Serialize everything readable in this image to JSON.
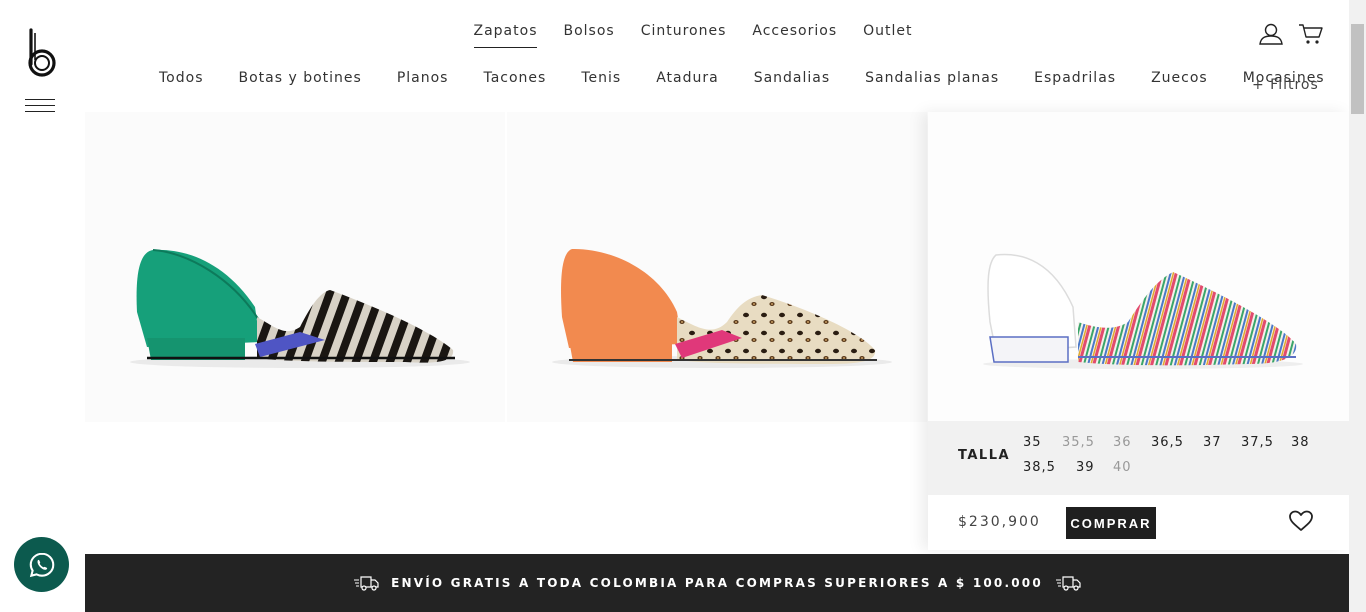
{
  "nav": {
    "items": [
      {
        "label": "Zapatos",
        "active": true
      },
      {
        "label": "Bolsos",
        "active": false
      },
      {
        "label": "Cinturones",
        "active": false
      },
      {
        "label": "Accesorios",
        "active": false
      },
      {
        "label": "Outlet",
        "active": false
      }
    ]
  },
  "header_icons": [
    "user-icon",
    "cart-icon"
  ],
  "categories": [
    "Todos",
    "Botas y botines",
    "Planos",
    "Tacones",
    "Tenis",
    "Atadura",
    "Sandalias",
    "Sandalias planas",
    "Espadrilas",
    "Zuecos",
    "Mocasines"
  ],
  "filters_label": "+ Filtros",
  "products": [
    {
      "image": "green-zebra-flat-shoe"
    },
    {
      "image": "orange-leopard-flat-shoe"
    },
    {
      "image": "white-striped-flat-shoe",
      "size_label": "TALLA",
      "sizes": [
        {
          "value": "35",
          "available": true
        },
        {
          "value": "35,5",
          "available": false
        },
        {
          "value": "36",
          "available": false
        },
        {
          "value": "36,5",
          "available": true
        },
        {
          "value": "37",
          "available": true
        },
        {
          "value": "37,5",
          "available": true
        },
        {
          "value": "38",
          "available": true
        },
        {
          "value": "38,5",
          "available": true
        },
        {
          "value": "39",
          "available": true
        },
        {
          "value": "40",
          "available": false
        }
      ],
      "price": "$230,900",
      "buy_label": "COMPRAR"
    }
  ],
  "promo": {
    "text": "ENVÍO GRATIS A TODA COLOMBIA PARA COMPRAS SUPERIORES A $ 100.000"
  },
  "colors": {
    "promo_bg": "#232323",
    "whatsapp": "#0c5a4e",
    "size_panel": "#f1f1f1"
  }
}
